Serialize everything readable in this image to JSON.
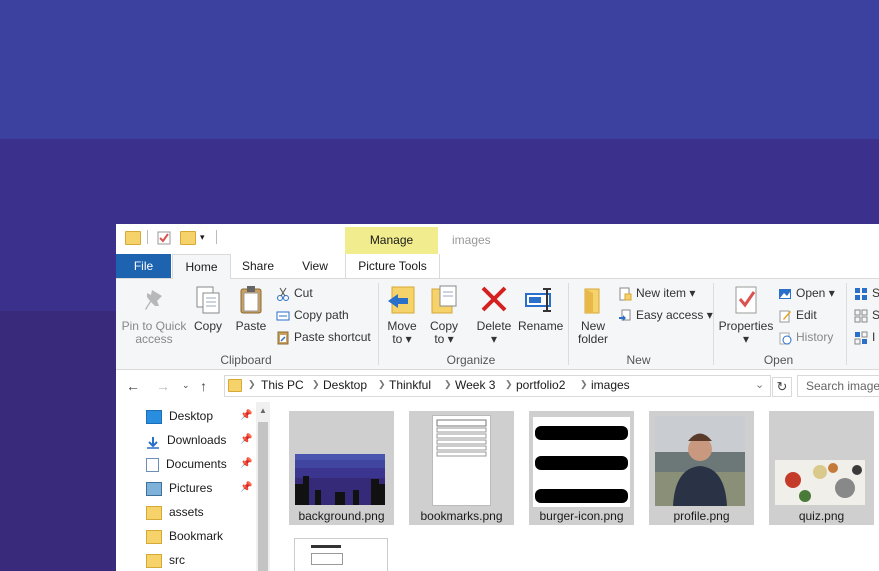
{
  "window": {
    "title": "images"
  },
  "context_tab": {
    "manage": "Manage",
    "picture_tools": "Picture Tools"
  },
  "tabs": {
    "file": "File",
    "home": "Home",
    "share": "Share",
    "view": "View"
  },
  "ribbon": {
    "clipboard": {
      "label": "Clipboard",
      "pin_line1": "Pin to Quick",
      "pin_line2": "access",
      "copy": "Copy",
      "paste": "Paste",
      "cut": "Cut",
      "copy_path": "Copy path",
      "paste_shortcut": "Paste shortcut"
    },
    "organize": {
      "label": "Organize",
      "move_line1": "Move",
      "move_line2": "to ▾",
      "copyto_line1": "Copy",
      "copyto_line2": "to ▾",
      "delete": "Delete",
      "delete_arrow": "▾",
      "rename": "Rename"
    },
    "new": {
      "label": "New",
      "folder_line1": "New",
      "folder_line2": "folder",
      "new_item": "New item ▾",
      "easy_access": "Easy access ▾"
    },
    "open": {
      "label": "Open",
      "properties": "Properties",
      "properties_arrow": "▾",
      "open": "Open ▾",
      "edit": "Edit",
      "history": "History"
    },
    "select": {
      "s1": "S",
      "s2": "S",
      "s3": "I"
    }
  },
  "address": {
    "crumbs": [
      "This PC",
      "Desktop",
      "Thinkful",
      "Week 3",
      "portfolio2",
      "images"
    ],
    "search_placeholder": "Search images"
  },
  "nav": {
    "items": [
      {
        "label": "Desktop",
        "pinned": true
      },
      {
        "label": "Downloads",
        "pinned": true
      },
      {
        "label": "Documents",
        "pinned": true
      },
      {
        "label": "Pictures",
        "pinned": true
      },
      {
        "label": "assets",
        "pinned": false
      },
      {
        "label": "Bookmark",
        "pinned": false
      },
      {
        "label": "src",
        "pinned": false
      }
    ]
  },
  "files": [
    {
      "name": "background.png"
    },
    {
      "name": "bookmarks.png"
    },
    {
      "name": "burger-icon.png"
    },
    {
      "name": "profile.png"
    },
    {
      "name": "quiz.png"
    }
  ],
  "colors": {
    "file_tab": "#1e63b0",
    "manage_tab": "#f1ec8d",
    "folder": "#f6d26b",
    "delete_red": "#d42020"
  }
}
